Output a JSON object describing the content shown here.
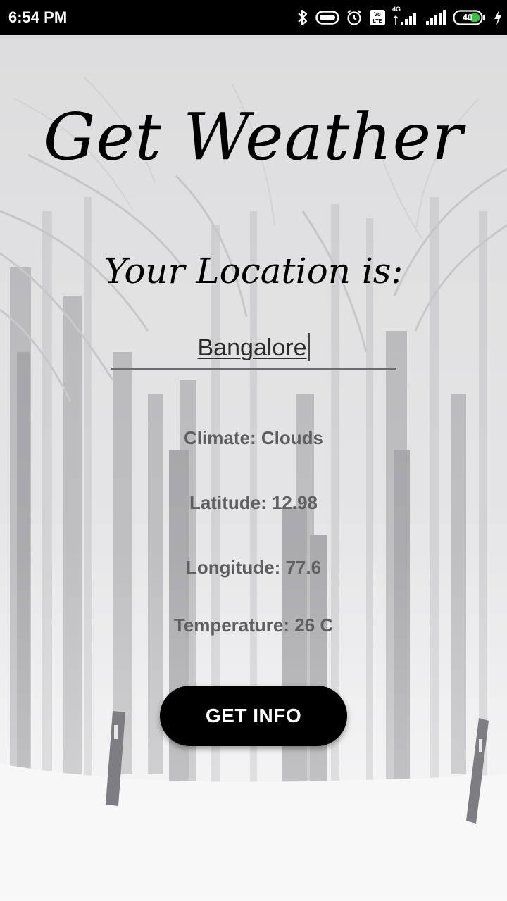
{
  "status_bar": {
    "time": "6:54 PM",
    "network_label": "4G",
    "battery_level": "40",
    "icons": [
      "bluetooth-icon",
      "vr-icon",
      "alarm-icon",
      "volte-icon",
      "signal-4g-icon",
      "signal-icon",
      "battery-icon",
      "charging-icon"
    ]
  },
  "app": {
    "title": "Get Weather",
    "location_heading": "Your Location is:"
  },
  "location_input": {
    "value": "Bangalore"
  },
  "weather": {
    "climate": "Climate: Clouds",
    "latitude": "Latitude: 12.98",
    "longitude": "Longitude: 77.6",
    "temperature": "Temperature: 26 C"
  },
  "actions": {
    "get_info_label": "GET INFO"
  },
  "colors": {
    "status_bar_bg": "#000000",
    "button_bg": "#000000",
    "button_text": "#ffffff",
    "info_text": "#5f5f62",
    "background": "#d9dadc"
  }
}
